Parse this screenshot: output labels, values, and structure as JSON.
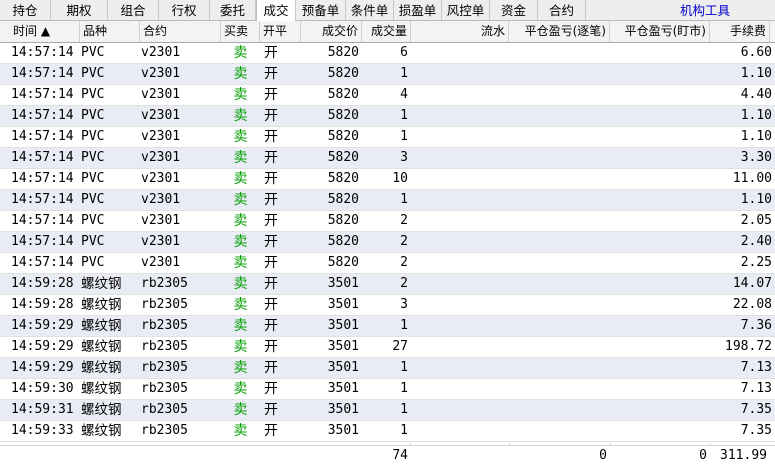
{
  "tabs": [
    {
      "label": "持仓"
    },
    {
      "label": "期权"
    },
    {
      "label": "组合"
    },
    {
      "label": "行权"
    },
    {
      "label": "委托"
    },
    {
      "label": "成交"
    },
    {
      "label": "预备单"
    },
    {
      "label": "条件单"
    },
    {
      "label": "损盈单"
    },
    {
      "label": "风控单"
    },
    {
      "label": "资金"
    },
    {
      "label": "合约"
    }
  ],
  "tool_tab": "机构工具",
  "columns": {
    "time": "时间 ▲",
    "variety": "品种",
    "contract": "合约",
    "side": "买卖",
    "openclose": "开平",
    "price": "成交价",
    "qty": "成交量",
    "flow": "流水",
    "pnl_close_mark": "平仓盈亏(逐笔)",
    "pnl_close_daily": "平仓盈亏(盯市)",
    "fee": "手续费"
  },
  "rows": [
    {
      "time": "14:57:14",
      "variety": "PVC",
      "contract": "v2301",
      "side": "卖",
      "openclose": "开",
      "price": "5820",
      "qty": "6",
      "fee": "6.60"
    },
    {
      "time": "14:57:14",
      "variety": "PVC",
      "contract": "v2301",
      "side": "卖",
      "openclose": "开",
      "price": "5820",
      "qty": "1",
      "fee": "1.10"
    },
    {
      "time": "14:57:14",
      "variety": "PVC",
      "contract": "v2301",
      "side": "卖",
      "openclose": "开",
      "price": "5820",
      "qty": "4",
      "fee": "4.40"
    },
    {
      "time": "14:57:14",
      "variety": "PVC",
      "contract": "v2301",
      "side": "卖",
      "openclose": "开",
      "price": "5820",
      "qty": "1",
      "fee": "1.10"
    },
    {
      "time": "14:57:14",
      "variety": "PVC",
      "contract": "v2301",
      "side": "卖",
      "openclose": "开",
      "price": "5820",
      "qty": "1",
      "fee": "1.10"
    },
    {
      "time": "14:57:14",
      "variety": "PVC",
      "contract": "v2301",
      "side": "卖",
      "openclose": "开",
      "price": "5820",
      "qty": "3",
      "fee": "3.30"
    },
    {
      "time": "14:57:14",
      "variety": "PVC",
      "contract": "v2301",
      "side": "卖",
      "openclose": "开",
      "price": "5820",
      "qty": "10",
      "fee": "11.00"
    },
    {
      "time": "14:57:14",
      "variety": "PVC",
      "contract": "v2301",
      "side": "卖",
      "openclose": "开",
      "price": "5820",
      "qty": "1",
      "fee": "1.10"
    },
    {
      "time": "14:57:14",
      "variety": "PVC",
      "contract": "v2301",
      "side": "卖",
      "openclose": "开",
      "price": "5820",
      "qty": "2",
      "fee": "2.05"
    },
    {
      "time": "14:57:14",
      "variety": "PVC",
      "contract": "v2301",
      "side": "卖",
      "openclose": "开",
      "price": "5820",
      "qty": "2",
      "fee": "2.40"
    },
    {
      "time": "14:57:14",
      "variety": "PVC",
      "contract": "v2301",
      "side": "卖",
      "openclose": "开",
      "price": "5820",
      "qty": "2",
      "fee": "2.25"
    },
    {
      "time": "14:59:28",
      "variety": "螺纹钢",
      "contract": "rb2305",
      "side": "卖",
      "openclose": "开",
      "price": "3501",
      "qty": "2",
      "fee": "14.07"
    },
    {
      "time": "14:59:28",
      "variety": "螺纹钢",
      "contract": "rb2305",
      "side": "卖",
      "openclose": "开",
      "price": "3501",
      "qty": "3",
      "fee": "22.08"
    },
    {
      "time": "14:59:29",
      "variety": "螺纹钢",
      "contract": "rb2305",
      "side": "卖",
      "openclose": "开",
      "price": "3501",
      "qty": "1",
      "fee": "7.36"
    },
    {
      "time": "14:59:29",
      "variety": "螺纹钢",
      "contract": "rb2305",
      "side": "卖",
      "openclose": "开",
      "price": "3501",
      "qty": "27",
      "fee": "198.72"
    },
    {
      "time": "14:59:29",
      "variety": "螺纹钢",
      "contract": "rb2305",
      "side": "卖",
      "openclose": "开",
      "price": "3501",
      "qty": "1",
      "fee": "7.13"
    },
    {
      "time": "14:59:30",
      "variety": "螺纹钢",
      "contract": "rb2305",
      "side": "卖",
      "openclose": "开",
      "price": "3501",
      "qty": "1",
      "fee": "7.13"
    },
    {
      "time": "14:59:31",
      "variety": "螺纹钢",
      "contract": "rb2305",
      "side": "卖",
      "openclose": "开",
      "price": "3501",
      "qty": "1",
      "fee": "7.35"
    },
    {
      "time": "14:59:33",
      "variety": "螺纹钢",
      "contract": "rb2305",
      "side": "卖",
      "openclose": "开",
      "price": "3501",
      "qty": "1",
      "fee": "7.35"
    }
  ],
  "totals": {
    "qty": "74",
    "pnl_close_mark": "0",
    "pnl_close_daily": "0",
    "fee": "311.99"
  },
  "colors": {
    "sell": "#00a000",
    "tool_tab": "#0000cc",
    "row_alt": "#e9ecf5"
  }
}
